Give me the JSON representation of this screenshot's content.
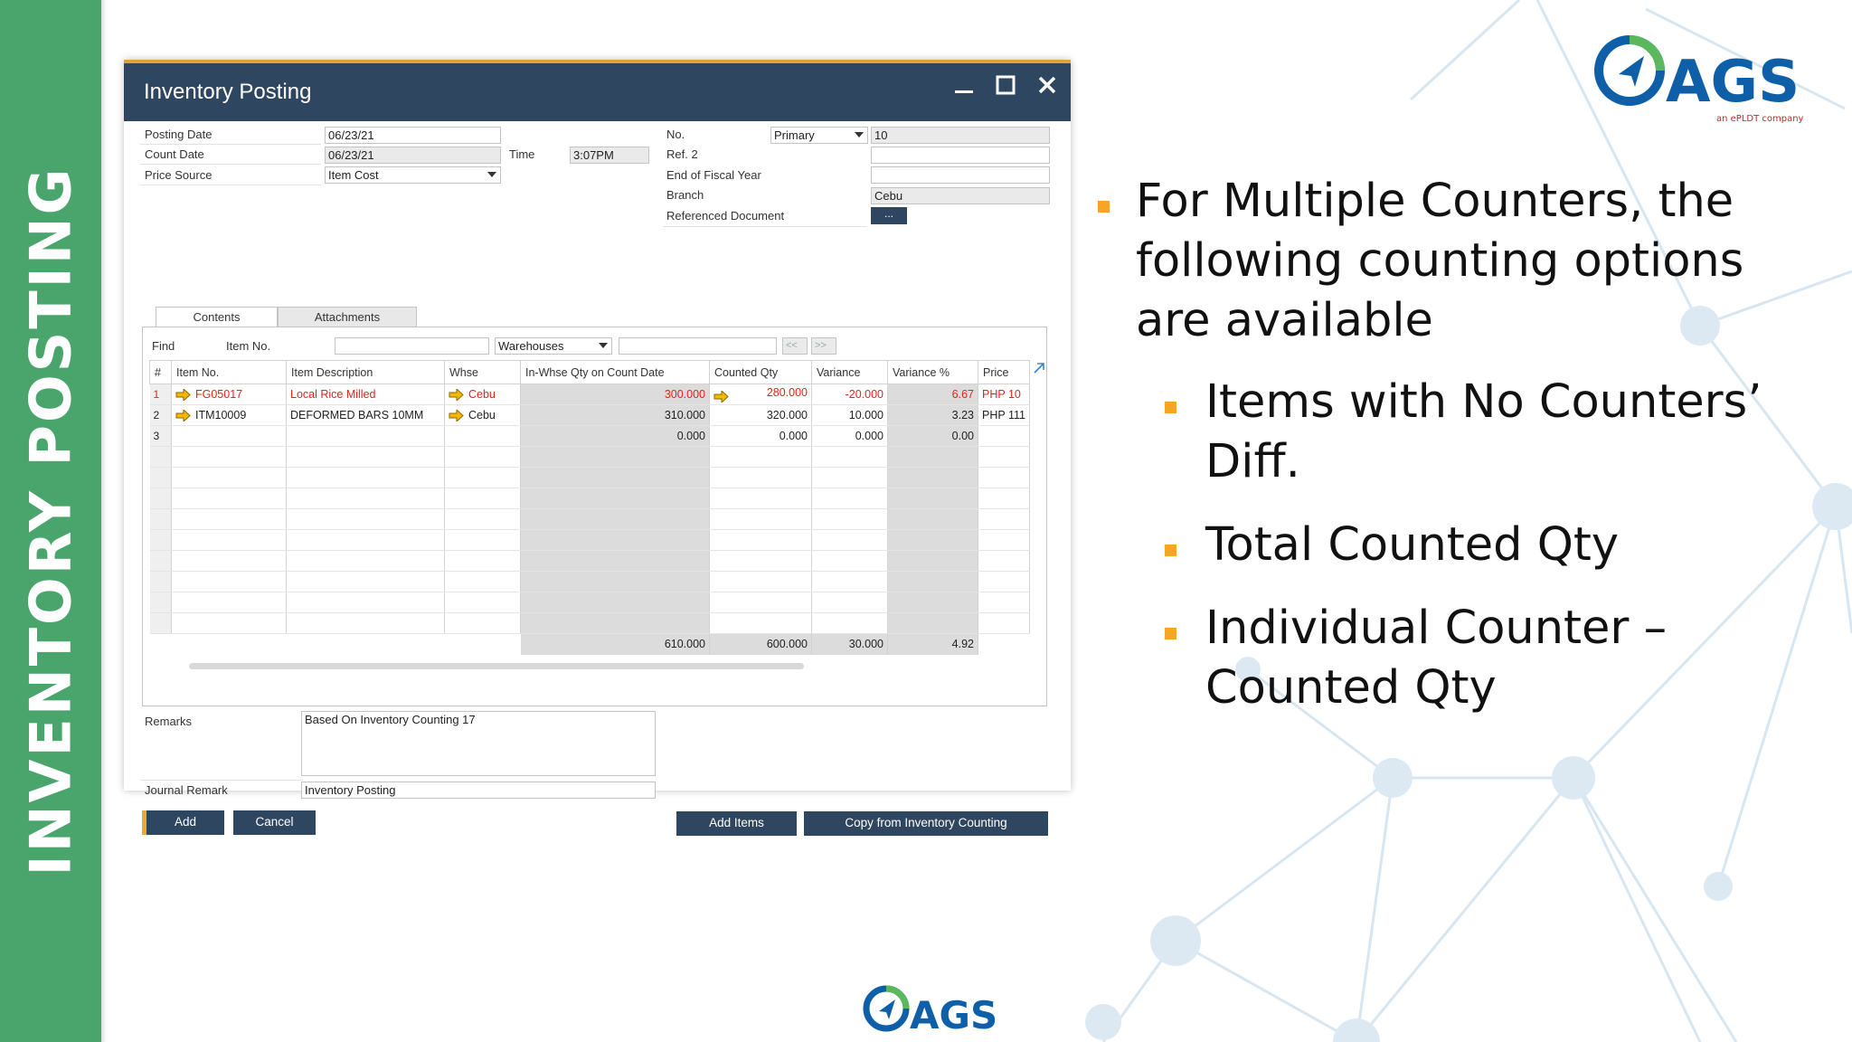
{
  "slide": {
    "side_title": "INVENTORY POSTING",
    "logo_text": "AGS",
    "logo_sub": "an ePLDT company"
  },
  "window": {
    "title": "Inventory Posting",
    "header": {
      "posting_date_label": "Posting Date",
      "posting_date": "06/23/21",
      "count_date_label": "Count Date",
      "count_date": "06/23/21",
      "time_label": "Time",
      "time": "3:07PM",
      "price_source_label": "Price Source",
      "price_source": "Item Cost",
      "no_label": "No.",
      "series": "Primary",
      "no": "10",
      "ref2_label": "Ref. 2",
      "ref2": "",
      "end_fiscal_label": "End of Fiscal Year",
      "branch_label": "Branch",
      "branch": "Cebu",
      "ref_doc_label": "Referenced Document",
      "ref_doc_button": "..."
    },
    "tabs": [
      "Contents",
      "Attachments"
    ],
    "find": {
      "find_label": "Find",
      "item_no_label": "Item No.",
      "warehouses": "Warehouses",
      "prev": "<<",
      "next": ">>"
    },
    "columns": [
      "#",
      "Item No.",
      "Item Description",
      "Whse",
      "In-Whse Qty on Count Date",
      "Counted Qty",
      "Variance",
      "Variance %",
      "Price"
    ],
    "rows": [
      {
        "n": "1",
        "item": "FG05017",
        "desc": "Local Rice Milled",
        "whse": "Cebu",
        "inwhse": "300.000",
        "counted": "280.000",
        "variance": "-20.000",
        "varpct": "6.67",
        "price": "PHP 10"
      },
      {
        "n": "2",
        "item": "ITM10009",
        "desc": "DEFORMED BARS 10MM",
        "whse": "Cebu",
        "inwhse": "310.000",
        "counted": "320.000",
        "variance": "10.000",
        "varpct": "3.23",
        "price": "PHP 111"
      },
      {
        "n": "3",
        "item": "",
        "desc": "",
        "whse": "",
        "inwhse": "0.000",
        "counted": "0.000",
        "variance": "0.000",
        "varpct": "0.00",
        "price": ""
      }
    ],
    "totals": {
      "inwhse": "610.000",
      "counted": "600.000",
      "variance": "30.000",
      "varpct": "4.92"
    },
    "remarks_label": "Remarks",
    "remarks": "Based On Inventory Counting 17",
    "journal_label": "Journal Remark",
    "journal": "Inventory Posting",
    "buttons": {
      "add": "Add",
      "cancel": "Cancel",
      "add_items": "Add Items",
      "copy": "Copy from Inventory Counting"
    }
  },
  "bullets": {
    "main": "For Multiple Counters, the following counting options are available",
    "sub": [
      "Items with No Counters’ Diff.",
      "Total Counted Qty",
      "Individual Counter – Counted Qty"
    ]
  },
  "colors": {
    "green": "#4aa56c",
    "window_title": "#2e4660",
    "accent": "#f5a623",
    "red_row": "#e0241b"
  }
}
